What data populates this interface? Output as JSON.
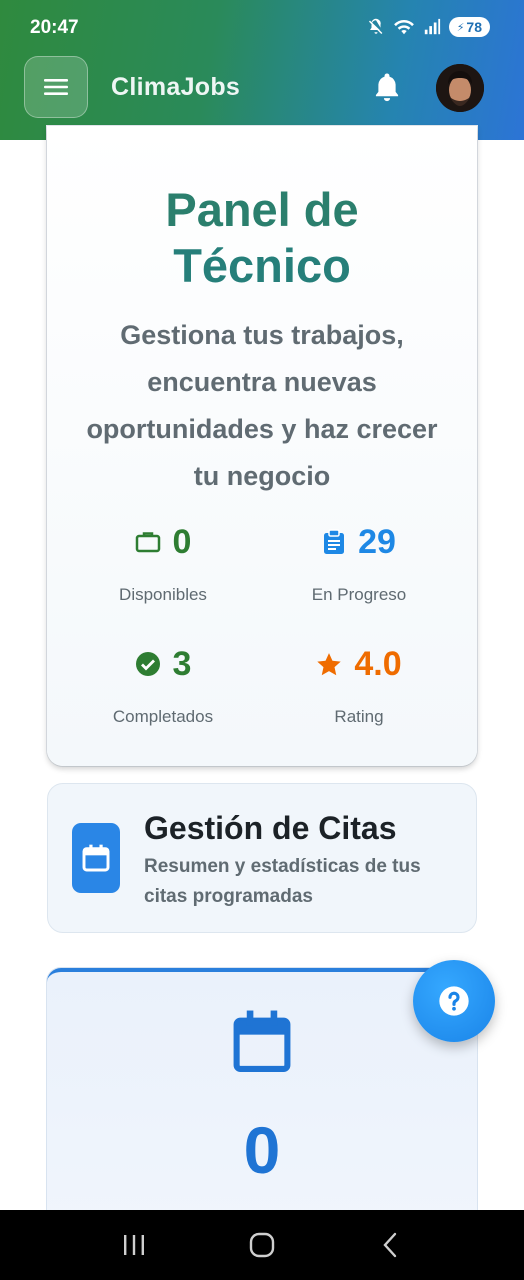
{
  "status_bar": {
    "time": "20:47",
    "battery": "78"
  },
  "app_bar": {
    "title": "ClimaJobs"
  },
  "panel": {
    "title_line1": "Panel de",
    "title_line2": "Técnico",
    "description": "Gestiona tus trabajos, encuentra nuevas oportunidades y haz crecer tu negocio",
    "stats": [
      {
        "value": "0",
        "label": "Disponibles",
        "icon": "briefcase-icon",
        "color": "#2e7d32"
      },
      {
        "value": "29",
        "label": "En Progreso",
        "icon": "clipboard-icon",
        "color": "#1e88e5"
      },
      {
        "value": "3",
        "label": "Completados",
        "icon": "check-circle-icon",
        "color": "#2e7d32"
      },
      {
        "value": "4.0",
        "label": "Rating",
        "icon": "star-icon",
        "color": "#ef6c00"
      }
    ]
  },
  "citas": {
    "title": "Gestión de Citas",
    "subtitle": "Resumen y estadísticas de tus citas programadas"
  },
  "stat_card": {
    "value": "0"
  },
  "colors": {
    "primary_green": "#2b7f6d",
    "primary_blue": "#2a86e6",
    "accent_orange": "#ef6c00"
  }
}
